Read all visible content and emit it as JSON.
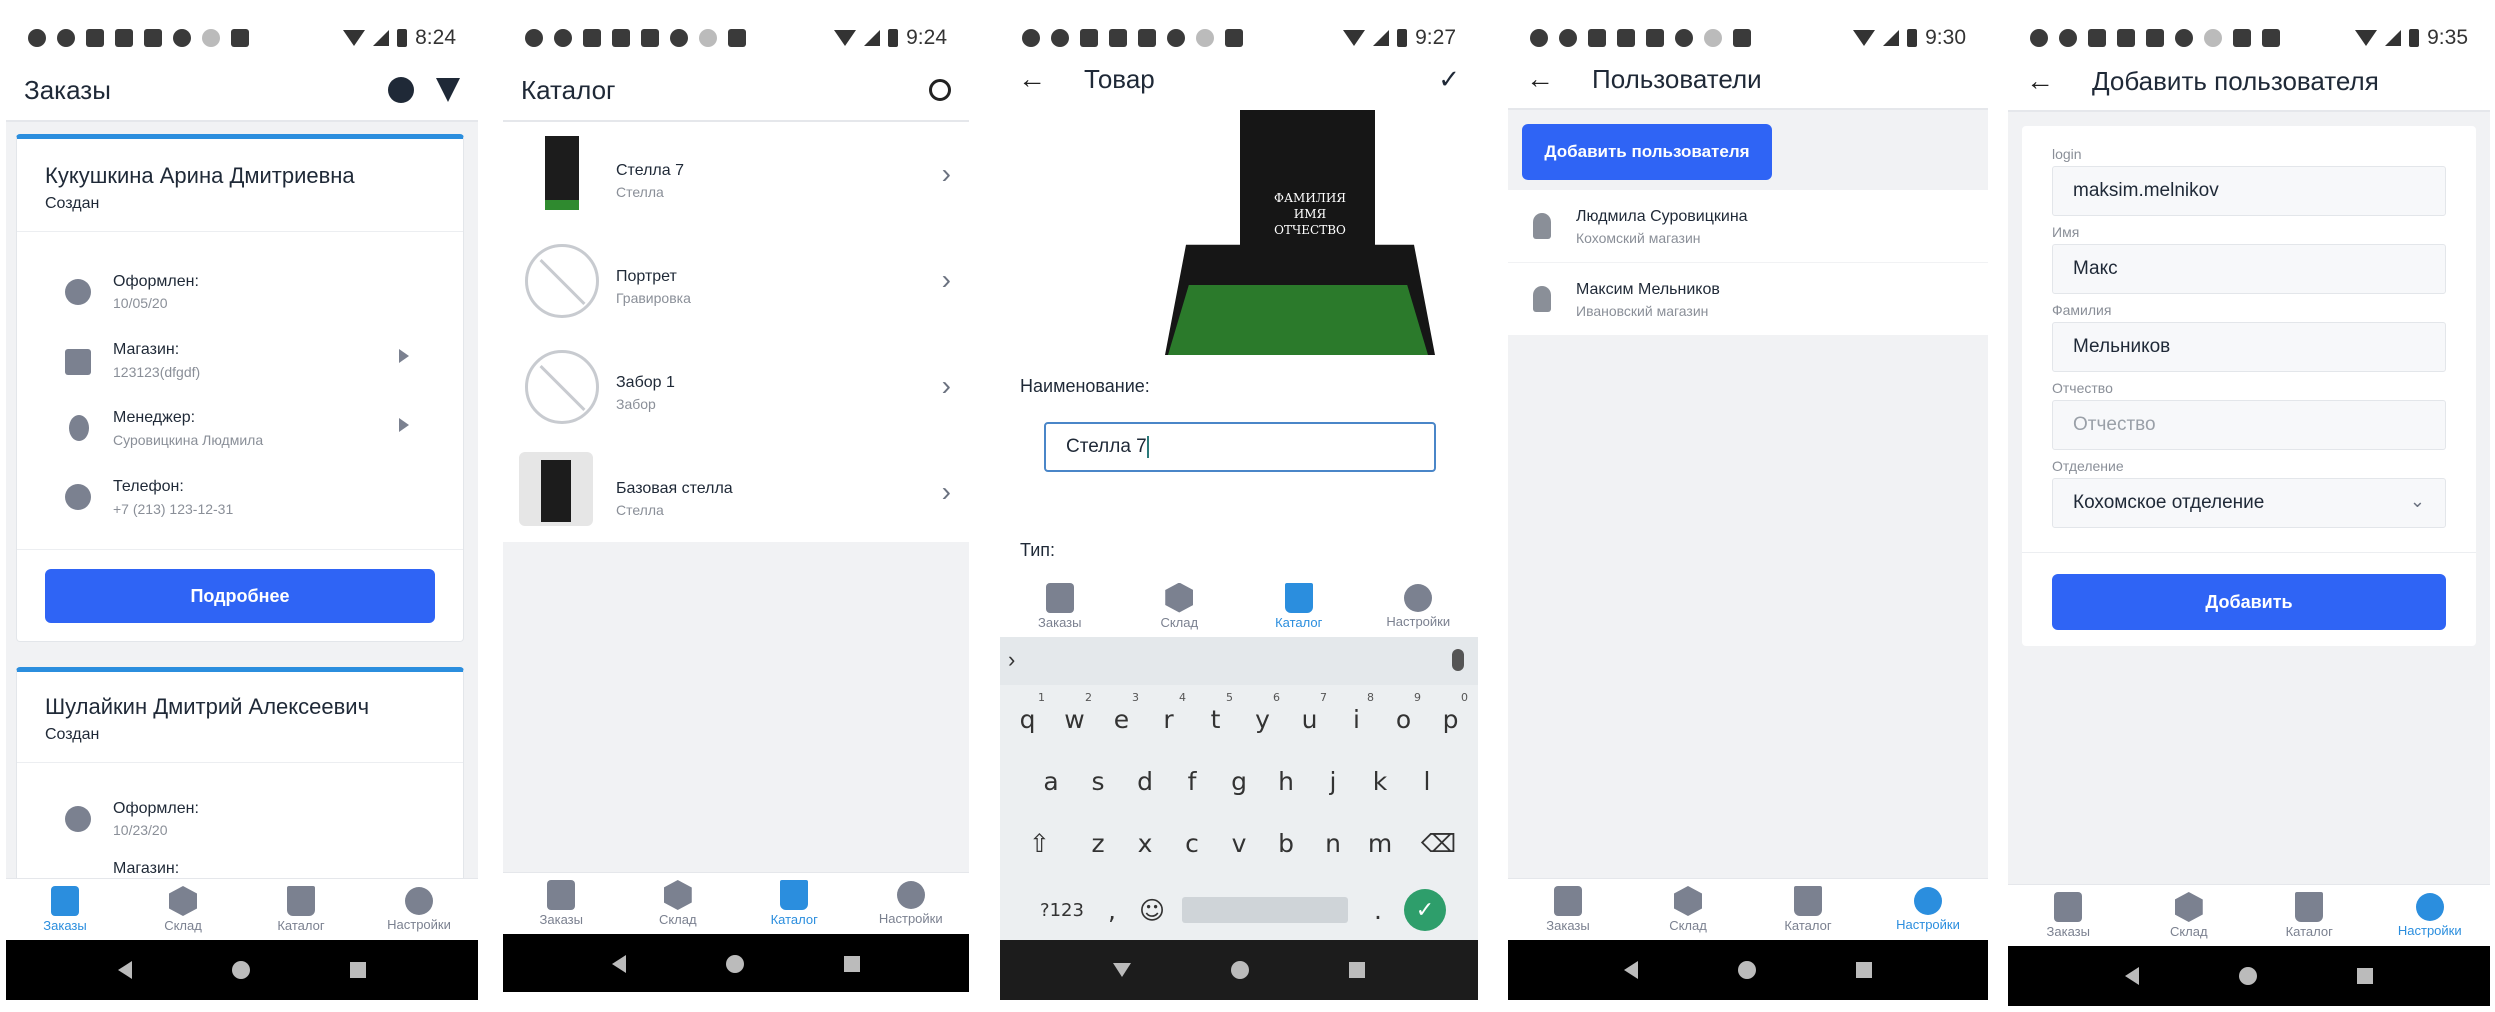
{
  "common": {
    "nav": {
      "orders": "Заказы",
      "warehouse": "Склад",
      "catalog": "Каталог",
      "settings": "Настройки"
    }
  },
  "screen1": {
    "time": "8:24",
    "title": "Заказы",
    "cards": [
      {
        "name": "Кукушкина Арина Дмитриевна",
        "status": "Создан",
        "rows": [
          {
            "label": "Оформлен:",
            "value": "10/05/20"
          },
          {
            "label": "Магазин:",
            "value": "123123(dfgdf)"
          },
          {
            "label": "Менеджер:",
            "value": "Суровицкина Людмила"
          },
          {
            "label": "Телефон:",
            "value": "+7 (213) 123-12-31"
          }
        ],
        "button": "Подробнее"
      },
      {
        "name": "Шулайкин Дмитрий Алексеевич",
        "status": "Создан",
        "rows": [
          {
            "label": "Оформлен:",
            "value": "10/23/20"
          },
          {
            "label": "Магазин:",
            "value": ""
          }
        ]
      }
    ]
  },
  "screen2": {
    "time": "9:24",
    "title": "Каталог",
    "items": [
      {
        "name": "Стелла 7",
        "type": "Стелла"
      },
      {
        "name": "Портрет",
        "type": "Гравировка"
      },
      {
        "name": "Забор 1",
        "type": "Забор"
      },
      {
        "name": "Базовая стелла",
        "type": "Стелла"
      }
    ]
  },
  "screen3": {
    "time": "9:27",
    "title": "Товар",
    "plaque_line1": "ФАМИЛИЯ",
    "plaque_line2": "ИМЯ",
    "plaque_line3": "ОТЧЕСТВО",
    "name_label": "Наименование:",
    "name_value": "Стелла 7",
    "type_label": "Тип:",
    "keyboard": {
      "row1": [
        "q",
        "w",
        "e",
        "r",
        "t",
        "y",
        "u",
        "i",
        "o",
        "p"
      ],
      "row1_digits": [
        "1",
        "2",
        "3",
        "4",
        "5",
        "6",
        "7",
        "8",
        "9",
        "0"
      ],
      "row2": [
        "a",
        "s",
        "d",
        "f",
        "g",
        "h",
        "j",
        "k",
        "l"
      ],
      "row3": [
        "z",
        "x",
        "c",
        "v",
        "b",
        "n",
        "m"
      ],
      "symbols": "?123",
      "comma": ",",
      "period": "."
    }
  },
  "screen4": {
    "time": "9:30",
    "title": "Пользователи",
    "add_button": "Добавить пользователя",
    "users": [
      {
        "name": "Людмила Суровицкина",
        "store": "Кохомский магазин"
      },
      {
        "name": "Максим Мельников",
        "store": "Ивановский магазин"
      }
    ]
  },
  "screen5": {
    "time": "9:35",
    "title": "Добавить пользователя",
    "fields": {
      "login_label": "login",
      "login_value": "maksim.melnikov",
      "name_label": "Имя",
      "name_value": "Макс",
      "surname_label": "Фамилия",
      "surname_value": "Мельников",
      "patronymic_label": "Отчество",
      "patronymic_placeholder": "Отчество",
      "department_label": "Отделение",
      "department_value": "Кохомское отделение"
    },
    "submit": "Добавить"
  }
}
